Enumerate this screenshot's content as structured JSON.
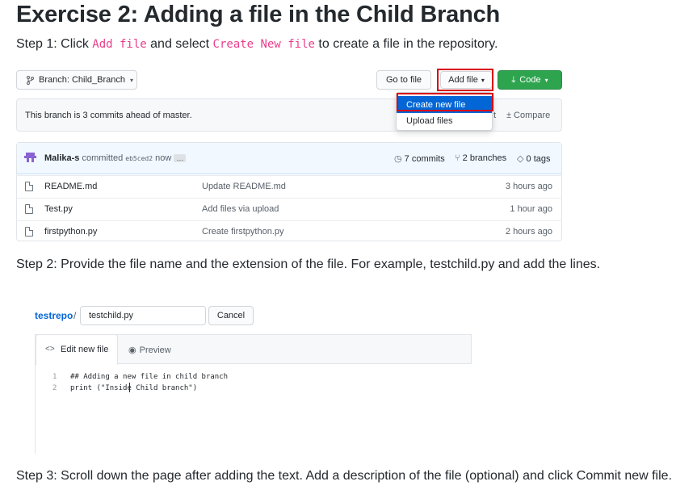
{
  "title": "Exercise 2: Adding a file in the Child Branch",
  "step1": {
    "prefix": "Step 1: Click ",
    "code1": "Add file",
    "mid": " and select ",
    "code2": "Create New file",
    "suffix": " to create a file in the repository."
  },
  "repo": {
    "branch_label": "Branch: Child_Branch",
    "goto_file": "Go to file",
    "add_file": "Add file",
    "code_button": "Code",
    "menu": [
      "Create new file",
      "Upload files"
    ],
    "ahead_text": "This branch is 3 commits ahead of master.",
    "ahead_partial": "t",
    "compare": "Compare",
    "commit": {
      "author": "Malika-s",
      "action": "committed",
      "sha": "eb5ced2",
      "when": "now",
      "ellipsis": "…"
    },
    "commits": "7 commits",
    "branches": "2 branches",
    "tags": "0 tags",
    "files": [
      {
        "name": "README.md",
        "message": "Update README.md",
        "time": "3 hours ago"
      },
      {
        "name": "Test.py",
        "message": "Add files via upload",
        "time": "1 hour ago"
      },
      {
        "name": "firstpython.py",
        "message": "Create firstpython.py",
        "time": "2 hours ago"
      }
    ]
  },
  "step2": "Step 2: Provide the file name and the extension of the file. For example, testchild.py and add the lines.",
  "editor": {
    "repo_link": "testrepo",
    "separator": "/",
    "filename": "testchild.py",
    "cancel": "Cancel",
    "tab_edit": "Edit new file",
    "tab_preview": "Preview",
    "lines": [
      {
        "no": "1",
        "text": "## Adding a new file in child branch"
      },
      {
        "no": "2",
        "text": "print (\"Inside Child branch\")"
      }
    ]
  },
  "step3": "Step 3: Scroll down the page after adding the text. Add a description of the file (optional) and click Commit new file.",
  "colors": {
    "accent_blue": "#0366d6",
    "green": "#2ea44f",
    "highlight_red": "#d7000f",
    "inline_code": "#e83e8c"
  }
}
